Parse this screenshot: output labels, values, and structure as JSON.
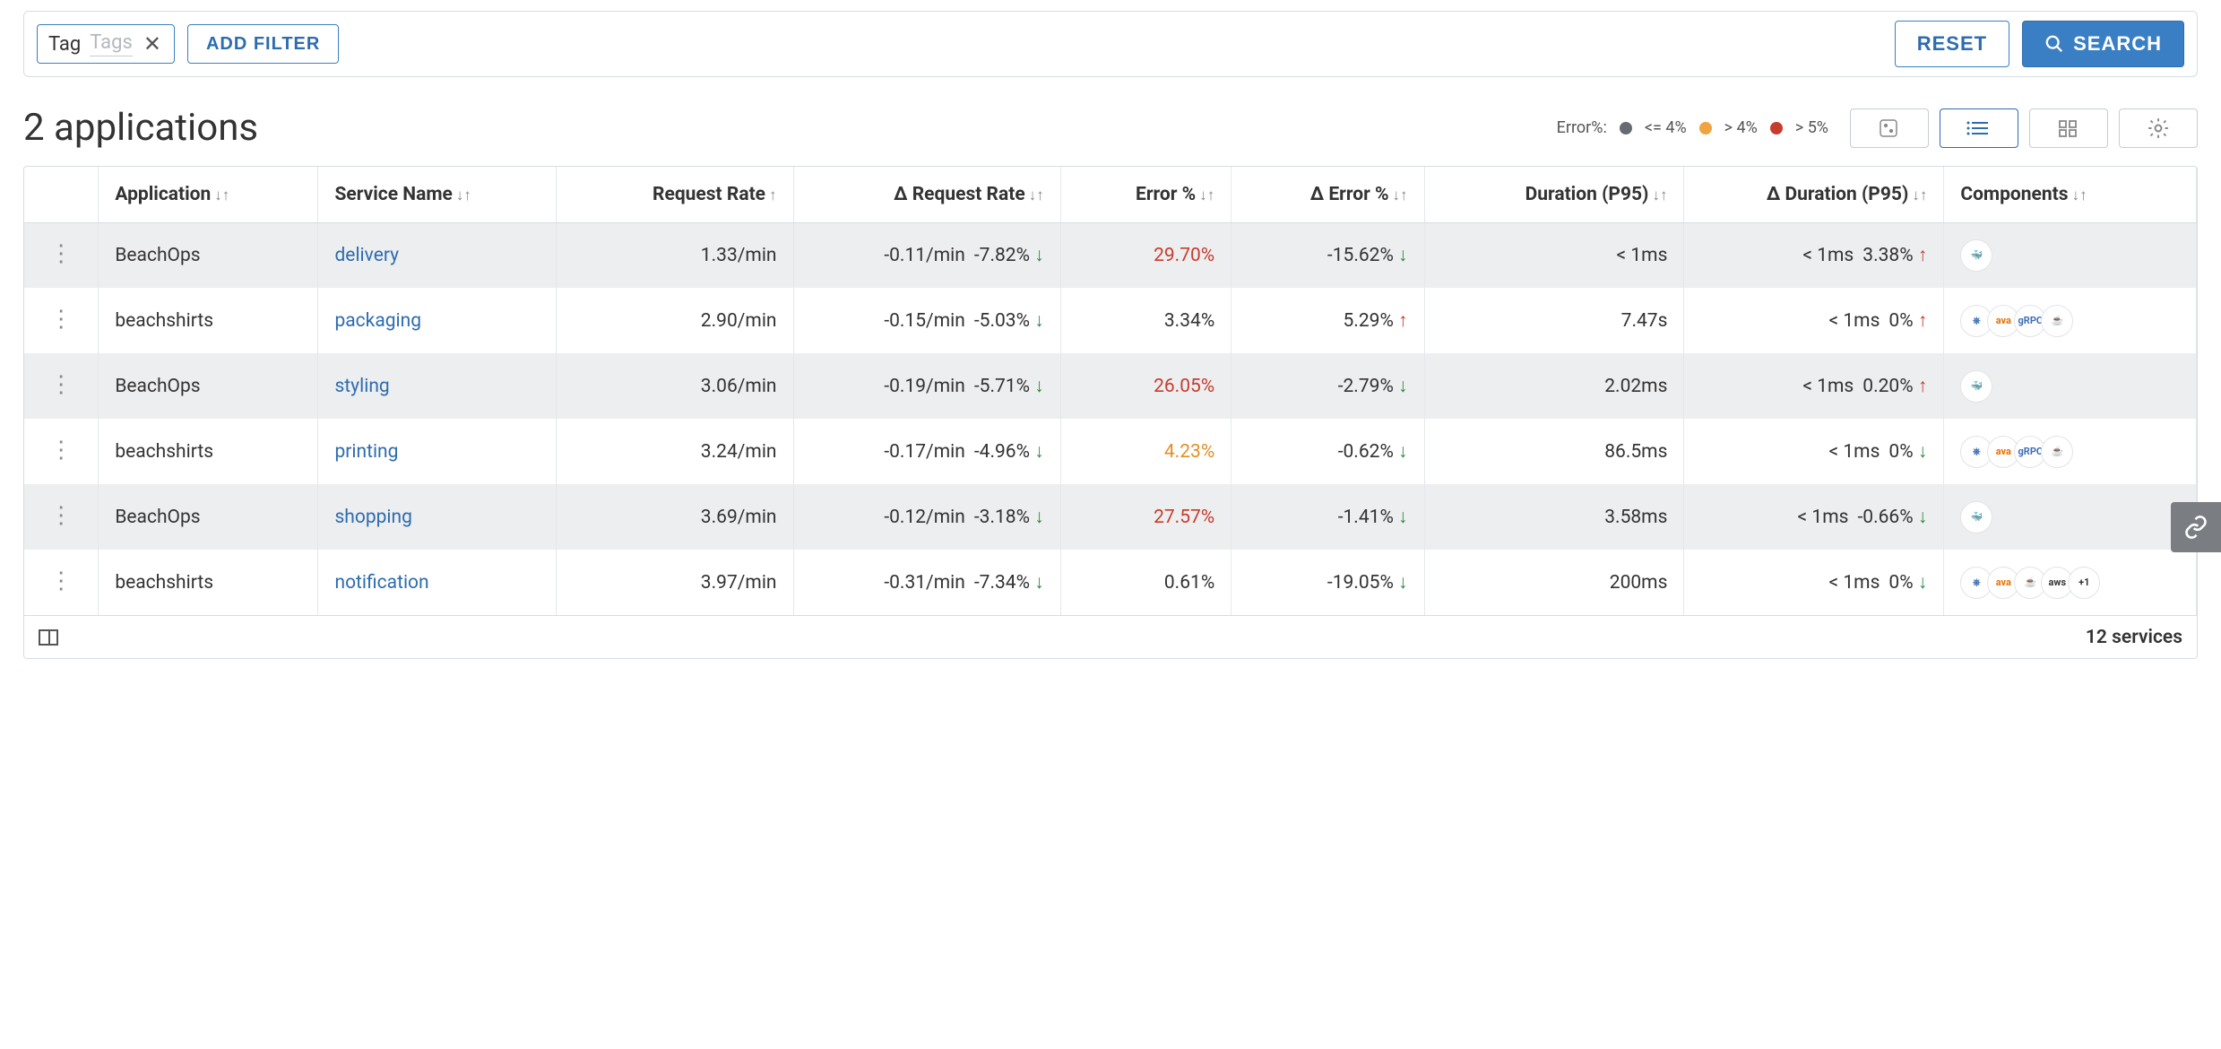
{
  "filter": {
    "tag_label": "Tag",
    "tag_placeholder": "Tags",
    "add_filter": "ADD FILTER",
    "reset": "RESET",
    "search": "SEARCH"
  },
  "title": "2 applications",
  "legend": {
    "label": "Error%:",
    "a": "<= 4%",
    "b": "> 4%",
    "c": "> 5%"
  },
  "columns": {
    "app": "Application",
    "svc": "Service Name",
    "rr": "Request Rate",
    "drr": "Δ Request Rate",
    "err": "Error %",
    "derr": "Δ Error %",
    "dur": "Duration (P95)",
    "ddur": "Δ Duration (P95)",
    "comp": "Components"
  },
  "rows": [
    {
      "app": "BeachOps",
      "svc": "delivery",
      "rr": "1.33/min",
      "drr_v": "-0.11/min",
      "drr_p": "-7.82%",
      "drr_dir": "down",
      "err": "29.70%",
      "err_sev": "high",
      "derr": "-15.62%",
      "derr_dir": "down",
      "dur": "< 1ms",
      "ddur": "< 1ms",
      "ddur_p": "3.38%",
      "ddur_dir": "up",
      "comp": [
        "wf"
      ]
    },
    {
      "app": "beachshirts",
      "svc": "packaging",
      "rr": "2.90/min",
      "drr_v": "-0.15/min",
      "drr_p": "-5.03%",
      "drr_dir": "down",
      "err": "3.34%",
      "err_sev": "ok",
      "derr": "5.29%",
      "derr_dir": "up",
      "dur": "7.47s",
      "ddur": "< 1ms",
      "ddur_p": "0%",
      "ddur_dir": "up",
      "comp": [
        "istio",
        "java",
        "grpc",
        "java2"
      ]
    },
    {
      "app": "BeachOps",
      "svc": "styling",
      "rr": "3.06/min",
      "drr_v": "-0.19/min",
      "drr_p": "-5.71%",
      "drr_dir": "down",
      "err": "26.05%",
      "err_sev": "high",
      "derr": "-2.79%",
      "derr_dir": "down",
      "dur": "2.02ms",
      "ddur": "< 1ms",
      "ddur_p": "0.20%",
      "ddur_dir": "up",
      "comp": [
        "wf"
      ]
    },
    {
      "app": "beachshirts",
      "svc": "printing",
      "rr": "3.24/min",
      "drr_v": "-0.17/min",
      "drr_p": "-4.96%",
      "drr_dir": "down",
      "err": "4.23%",
      "err_sev": "mid",
      "derr": "-0.62%",
      "derr_dir": "down",
      "dur": "86.5ms",
      "ddur": "< 1ms",
      "ddur_p": "0%",
      "ddur_dir": "down",
      "comp": [
        "istio",
        "java",
        "grpc",
        "java2"
      ]
    },
    {
      "app": "BeachOps",
      "svc": "shopping",
      "rr": "3.69/min",
      "drr_v": "-0.12/min",
      "drr_p": "-3.18%",
      "drr_dir": "down",
      "err": "27.57%",
      "err_sev": "high",
      "derr": "-1.41%",
      "derr_dir": "down",
      "dur": "3.58ms",
      "ddur": "< 1ms",
      "ddur_p": "-0.66%",
      "ddur_dir": "down",
      "comp": [
        "wf"
      ]
    },
    {
      "app": "beachshirts",
      "svc": "notification",
      "rr": "3.97/min",
      "drr_v": "-0.31/min",
      "drr_p": "-7.34%",
      "drr_dir": "down",
      "err": "0.61%",
      "err_sev": "ok",
      "derr": "-19.05%",
      "derr_dir": "down",
      "dur": "200ms",
      "ddur": "< 1ms",
      "ddur_p": "0%",
      "ddud_dir": "down",
      "ddur_dir": "down",
      "comp": [
        "istio",
        "java",
        "java2",
        "aws",
        "more"
      ]
    }
  ],
  "footer": {
    "count": "12 services"
  },
  "comp_text": {
    "istio": "⎈",
    "java": "ava",
    "grpc": "gRPC",
    "java2": "☕",
    "aws": "aws",
    "more": "+1",
    "wf": "🐳"
  }
}
